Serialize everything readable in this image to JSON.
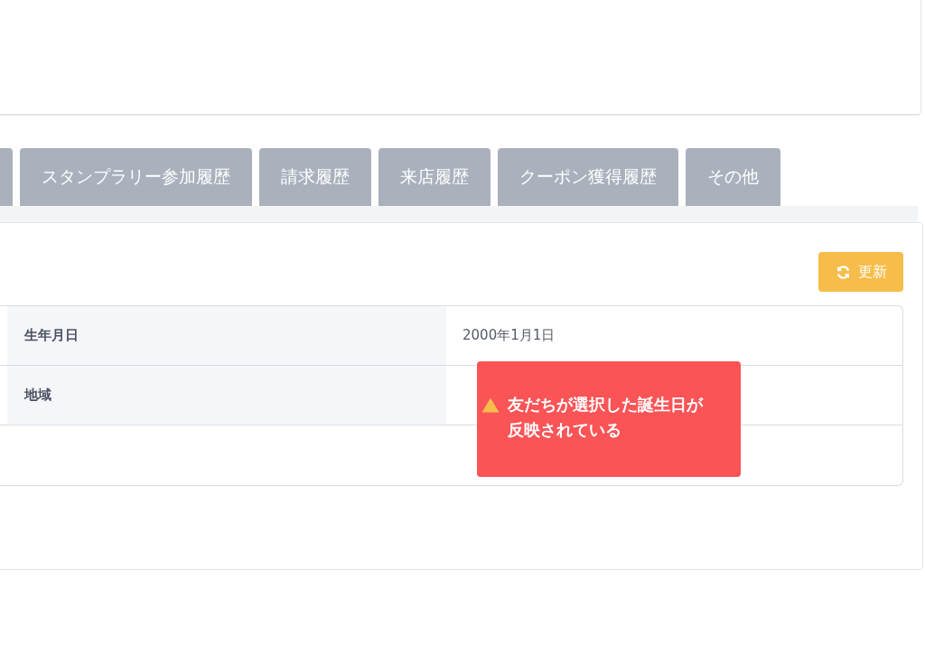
{
  "tabs": [
    {
      "selected": false
    },
    {
      "label": "スタンプラリー参加履歴",
      "selected": false
    },
    {
      "label": "請求履歴",
      "selected": false
    },
    {
      "label": "来店履歴",
      "selected": false
    },
    {
      "label": "クーポン獲得履歴",
      "selected": false
    },
    {
      "label": "その他",
      "selected": false
    }
  ],
  "refresh_button": {
    "label": "更新"
  },
  "table": {
    "rows": [
      {
        "label": "生年月日",
        "value": "2000年1月1日"
      },
      {
        "label": "地域"
      }
    ]
  },
  "annotation": {
    "text": "友だちが選択した誕生日が反映されている"
  }
}
